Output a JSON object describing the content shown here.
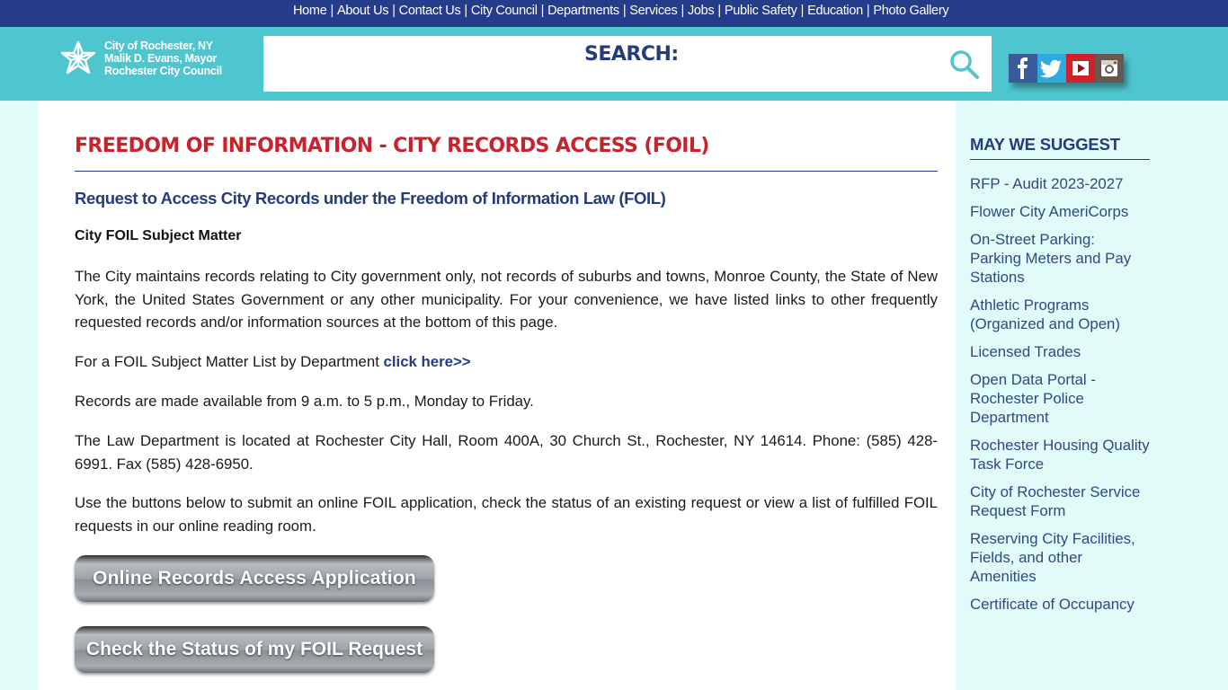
{
  "topnav": {
    "items": [
      "Home",
      "About Us",
      "Contact Us",
      "City Council",
      "Departments",
      "Services",
      "Jobs",
      "Public Safety",
      "Education",
      "Photo Gallery"
    ]
  },
  "header": {
    "logo_lines": [
      "City of Rochester, NY",
      "Malik D. Evans, Mayor",
      "Rochester City Council"
    ],
    "search_label": "SEARCH:",
    "search_value": "",
    "social": [
      "facebook",
      "twitter",
      "youtube",
      "instagram"
    ]
  },
  "main": {
    "title": "FREEDOM OF INFORMATION - CITY RECORDS ACCESS (FOIL)",
    "subtitle": "Request to Access City Records under the Freedom of Information Law (FOIL)",
    "section_head": "City FOIL Subject Matter",
    "p1": "The City maintains records relating to City government only, not records of suburbs and towns, Monroe County, the State of New York, the United States Government or any other municipality. For your convenience, we have listed links to other frequently requested records and/or information sources at the bottom of this page.",
    "p2_text": "For a FOIL Subject Matter List by Department ",
    "p2_link": "click here>>",
    "p3": "Records are made available from 9 a.m. to 5 p.m., Monday to Friday.",
    "p4": "The Law Department is located at Rochester City Hall, Room 400A, 30 Church St., Rochester, NY 14614.  Phone: (585) 428-6991. Fax (585) 428-6950.",
    "p5": "Use the buttons below to submit an online FOIL application, check the status of an existing request or view a list of fulfilled FOIL requests in our online reading room.",
    "button1": "Online Records Access Application",
    "button2": "Check the Status of my FOIL Request"
  },
  "sidebar": {
    "title": "MAY WE SUGGEST",
    "items": [
      "RFP - Audit 2023-2027",
      "Flower City AmeriCorps",
      "On-Street Parking: Parking Meters and Pay Stations",
      "Athletic Programs (Organized and Open)",
      "Licensed Trades",
      "Open Data Portal - Rochester Police Department",
      "Rochester Housing Quality Task Force",
      "City of Rochester Service Request Form",
      "Reserving City Facilities, Fields, and other Amenities",
      "Certificate of Occupancy"
    ]
  }
}
